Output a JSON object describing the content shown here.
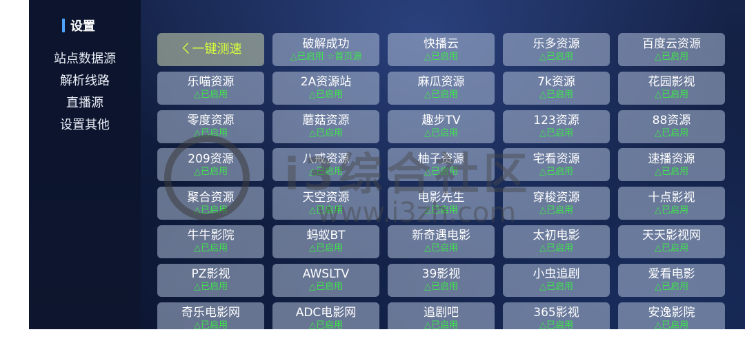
{
  "sidebar": {
    "title": "设置",
    "items": [
      {
        "label": "站点数据源"
      },
      {
        "label": "解析线路"
      },
      {
        "label": "直播源"
      },
      {
        "label": "设置其他"
      }
    ]
  },
  "colors": {
    "accent_bar": "#4fa3ff",
    "status_green": "#3ee64a",
    "speed_yellow": "#d8ff3a"
  },
  "sources": [
    {
      "title": "ㄑ一键测速",
      "status": "",
      "icon": "speed-test"
    },
    {
      "title": "破解成功",
      "status": "△已启用 ☆首页源"
    },
    {
      "title": "快播云",
      "status": "△已启用"
    },
    {
      "title": "乐多资源",
      "status": "△已启用"
    },
    {
      "title": "百度云资源",
      "status": "△已启用"
    },
    {
      "title": "乐喵资源",
      "status": "△已启用"
    },
    {
      "title": "2A资源站",
      "status": "△已启用"
    },
    {
      "title": "麻瓜资源",
      "status": "△已启用"
    },
    {
      "title": "7k资源",
      "status": "△已启用"
    },
    {
      "title": "花园影视",
      "status": "△已启用"
    },
    {
      "title": "零度资源",
      "status": "△已启用"
    },
    {
      "title": "蘑菇资源",
      "status": "△已启用"
    },
    {
      "title": "趣步TV",
      "status": "△已启用"
    },
    {
      "title": "123资源",
      "status": "△已启用"
    },
    {
      "title": "88资源",
      "status": "△已启用"
    },
    {
      "title": "209资源",
      "status": "△已启用"
    },
    {
      "title": "八戒资源",
      "status": "△已启用"
    },
    {
      "title": "柚子资源",
      "status": "△已启用"
    },
    {
      "title": "宅看资源",
      "status": "△已启用"
    },
    {
      "title": "速播资源",
      "status": "△已启用"
    },
    {
      "title": "聚合资源",
      "status": "△已启用"
    },
    {
      "title": "天空资源",
      "status": "△已启用"
    },
    {
      "title": "电影先生",
      "status": "△已启用"
    },
    {
      "title": "穿梭资源",
      "status": "△已启用"
    },
    {
      "title": "十点影视",
      "status": "△已启用"
    },
    {
      "title": "牛牛影院",
      "status": "△已启用"
    },
    {
      "title": "蚂蚁BT",
      "status": "△已启用"
    },
    {
      "title": "新奇遇电影",
      "status": "△已启用"
    },
    {
      "title": "太初电影",
      "status": "△已启用"
    },
    {
      "title": "天天影视网",
      "status": "△已启用"
    },
    {
      "title": "PZ影视",
      "status": "△已启用"
    },
    {
      "title": "AWSLTV",
      "status": "△已启用"
    },
    {
      "title": "39影视",
      "status": "△已启用"
    },
    {
      "title": "小虫追剧",
      "status": "△已启用"
    },
    {
      "title": "爱看电影",
      "status": "△已启用"
    },
    {
      "title": "奇乐电影网",
      "status": "△已启用"
    },
    {
      "title": "ADC电影网",
      "status": "△已启用"
    },
    {
      "title": "追剧吧",
      "status": "△已启用"
    },
    {
      "title": "365影视",
      "status": "△已启用"
    },
    {
      "title": "安逸影院",
      "status": "△已启用"
    }
  ],
  "watermark": {
    "text": "i3综合社区",
    "url": "www.i3zh.com"
  }
}
